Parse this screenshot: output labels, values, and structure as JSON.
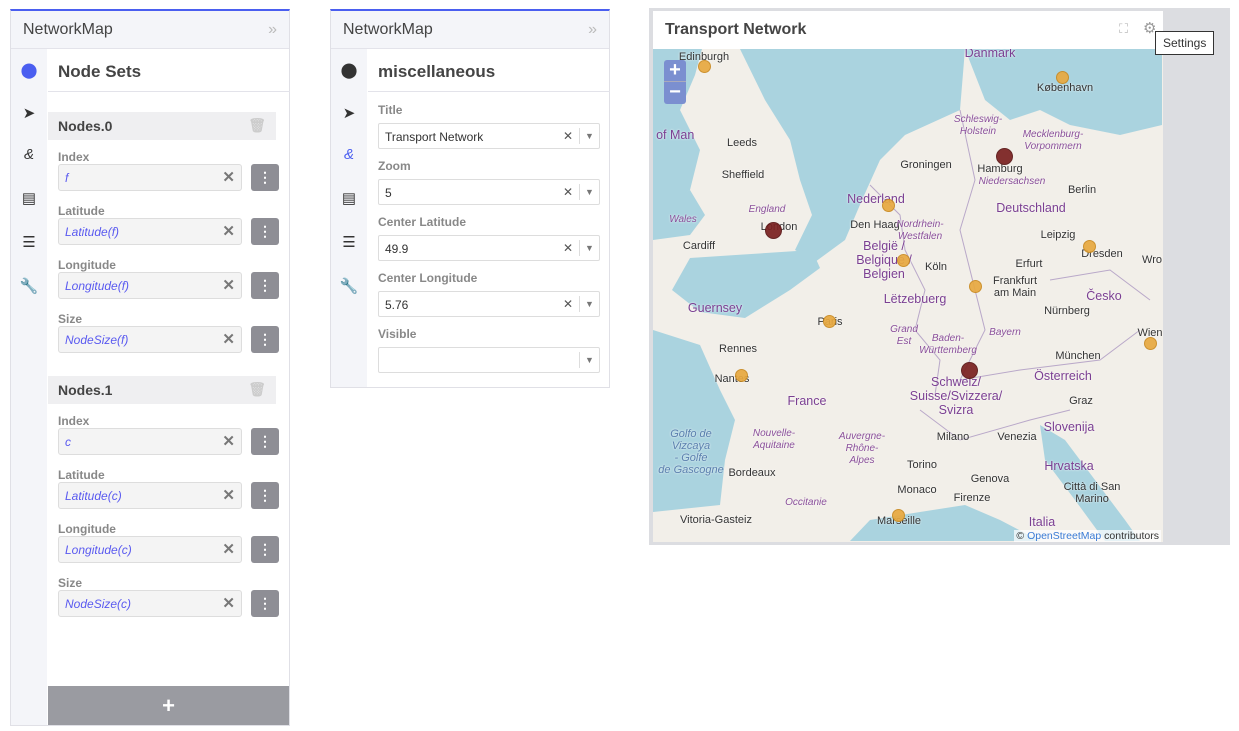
{
  "left_panel": {
    "app_title": "NetworkMap",
    "collapse_icon": "double-chevron-right",
    "section_title": "Node Sets",
    "groups": [
      {
        "title": "Nodes.0",
        "fields": [
          {
            "label": "Index",
            "value": "f"
          },
          {
            "label": "Latitude",
            "value": "Latitude(f)"
          },
          {
            "label": "Longitude",
            "value": "Longitude(f)"
          },
          {
            "label": "Size",
            "value": "NodeSize(f)"
          }
        ]
      },
      {
        "title": "Nodes.1",
        "fields": [
          {
            "label": "Index",
            "value": "c"
          },
          {
            "label": "Latitude",
            "value": "Latitude(c)"
          },
          {
            "label": "Longitude",
            "value": "Longitude(c)"
          },
          {
            "label": "Size",
            "value": "NodeSize(c)"
          }
        ]
      }
    ],
    "add_label": "+"
  },
  "rail_icons": [
    "map-marker",
    "navigation-arrow",
    "ampersand",
    "newspaper",
    "list-box",
    "wrench"
  ],
  "middle_panel": {
    "app_title": "NetworkMap",
    "section_title": "miscellaneous",
    "fields": [
      {
        "label": "Title",
        "value": "Transport Network"
      },
      {
        "label": "Zoom",
        "value": "5"
      },
      {
        "label": "Center Latitude",
        "value": "49.9"
      },
      {
        "label": "Center Longitude",
        "value": "5.76"
      },
      {
        "label": "Visible",
        "value": ""
      }
    ]
  },
  "map": {
    "title": "Transport Network",
    "zoom_in": "+",
    "zoom_out": "−",
    "tooltip": "Settings",
    "attribution_prefix": "©",
    "attribution_link": "OpenStreetMap",
    "attribution_suffix": "contributors",
    "colors": {
      "small_node": "#e8a940",
      "large_node": "#7a2020",
      "sea": "#aad3df",
      "land": "#f2efe9"
    },
    "labels": [
      "Edinburgh",
      "Danmark",
      "København",
      "e of Man",
      "Leeds",
      "Sheffield",
      "Groningen",
      "Hamburg",
      "Schleswig-\nHolstein",
      "Mecklenburg-\nVorpommern",
      "Niedersachsen",
      "Berlin",
      "Nederland",
      "Deutschland",
      "England",
      "Wales",
      "London",
      "Den Haag",
      "Nordrhein-\nWestfalen",
      "Leipzig",
      "Cardiff",
      "België /\nBelgique /\nBelgien",
      "Köln",
      "Erfurt",
      "Dresden",
      "Wro",
      "Frankfurt\nam Main",
      "Lëtzebuerg",
      "Česko",
      "Guernsey",
      "Nürnberg",
      "Paris",
      "Grand\nEst",
      "Baden-\nWürttemberg",
      "Bayern",
      "Rennes",
      "München",
      "Wien",
      "Nantes",
      "Österreich",
      "Schweiz/\nSuisse/Svizzera/\nSvizra",
      "France",
      "Graz",
      "Slovenija",
      "Golfo de\nVizcaya\n- Golfe\nde Gascogne",
      "Nouvelle-\nAquitaine",
      "Auvergne-\nRhône-\nAlpes",
      "Milano",
      "Venezia",
      "Bordeaux",
      "Torino",
      "Hrvatska",
      "Genova",
      "Città di San\nMarino",
      "Monaco",
      "Firenze",
      "Occitanie",
      "Vitoria-Gasteiz",
      "Marseille",
      "Italia"
    ],
    "nodes": [
      {
        "city": "Edinburgh",
        "size": "small"
      },
      {
        "city": "København",
        "size": "small"
      },
      {
        "city": "Nederland",
        "size": "small"
      },
      {
        "city": "Belgique",
        "size": "small"
      },
      {
        "city": "Frankfurt",
        "size": "small"
      },
      {
        "city": "Dresden",
        "size": "small"
      },
      {
        "city": "Paris",
        "size": "small"
      },
      {
        "city": "Wien",
        "size": "small"
      },
      {
        "city": "Nantes",
        "size": "small"
      },
      {
        "city": "Marseille",
        "size": "small"
      },
      {
        "city": "London",
        "size": "large"
      },
      {
        "city": "Hamburg",
        "size": "large"
      },
      {
        "city": "Schweiz",
        "size": "large"
      }
    ]
  }
}
